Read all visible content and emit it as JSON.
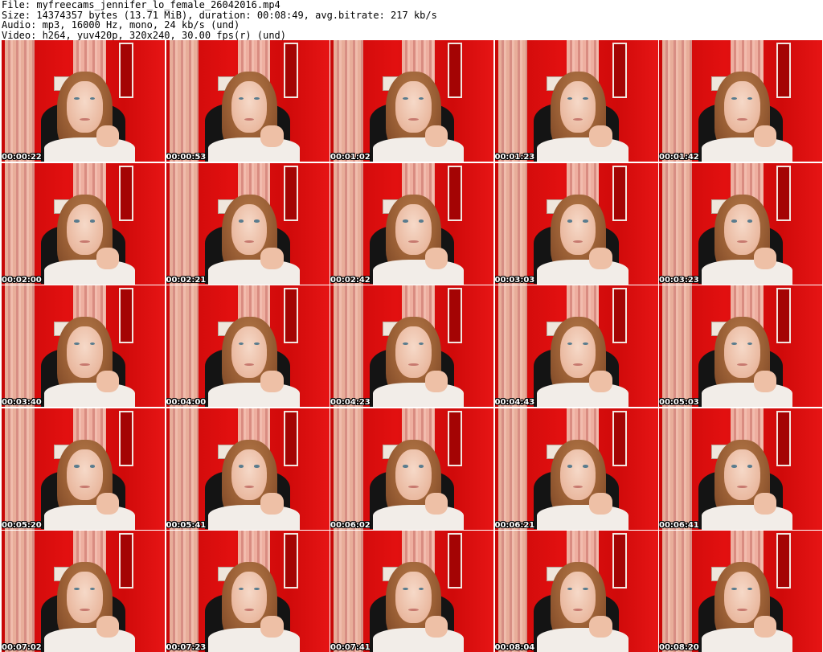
{
  "header": {
    "file": "File: myfreecams_jennifer_lo_female_26042016.mp4",
    "size": "Size: 14374357 bytes (13.71 MiB), duration: 00:08:49, avg.bitrate: 217 kb/s",
    "audio": "Audio: mp3, 16000 Hz, mono, 24 kb/s (und)",
    "video": "Video: h264, yuv420p, 320x240, 30.00 fps(r) (und)"
  },
  "thumbnails": [
    {
      "timestamp": "00:00:22"
    },
    {
      "timestamp": "00:00:53"
    },
    {
      "timestamp": "00:01:02"
    },
    {
      "timestamp": "00:01:23"
    },
    {
      "timestamp": "00:01:42"
    },
    {
      "timestamp": "00:02:00"
    },
    {
      "timestamp": "00:02:21"
    },
    {
      "timestamp": "00:02:42"
    },
    {
      "timestamp": "00:03:03"
    },
    {
      "timestamp": "00:03:23"
    },
    {
      "timestamp": "00:03:40"
    },
    {
      "timestamp": "00:04:00"
    },
    {
      "timestamp": "00:04:23"
    },
    {
      "timestamp": "00:04:43"
    },
    {
      "timestamp": "00:05:03"
    },
    {
      "timestamp": "00:05:20"
    },
    {
      "timestamp": "00:05:41"
    },
    {
      "timestamp": "00:06:02"
    },
    {
      "timestamp": "00:06:21"
    },
    {
      "timestamp": "00:06:41"
    },
    {
      "timestamp": "00:07:02"
    },
    {
      "timestamp": "00:07:23"
    },
    {
      "timestamp": "00:07:41"
    },
    {
      "timestamp": "00:08:04"
    },
    {
      "timestamp": "00:08:20"
    }
  ],
  "colors": {
    "background": "#ffffff",
    "text": "#000000",
    "wall_red": "#e21010",
    "timestamp_text": "#ffffff"
  }
}
